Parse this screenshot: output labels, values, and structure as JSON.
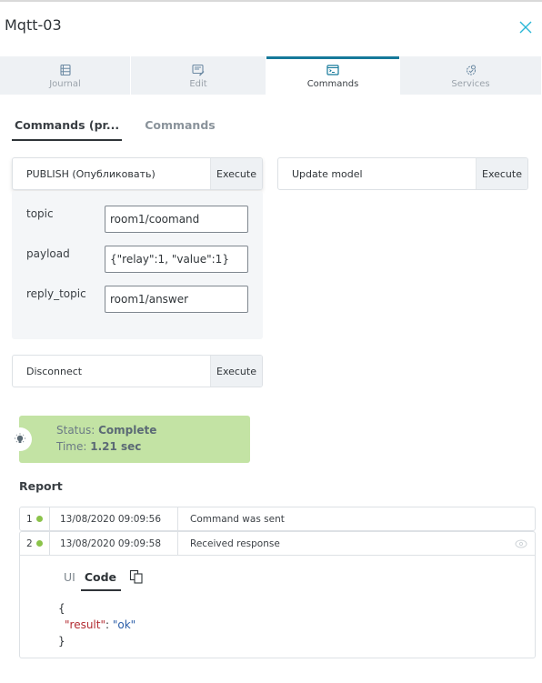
{
  "window": {
    "title": "Mqtt-03",
    "close_icon": "close-icon",
    "accent_color": "#15799a"
  },
  "tabs": [
    {
      "label": "Journal",
      "icon": "journal-icon",
      "active": false
    },
    {
      "label": "Edit",
      "icon": "edit-icon",
      "active": false
    },
    {
      "label": "Commands",
      "icon": "terminal-icon",
      "active": true
    },
    {
      "label": "Services",
      "icon": "services-gear-icon",
      "active": false
    }
  ],
  "subtabs": [
    {
      "label": "Commands (pr...",
      "active": true
    },
    {
      "label": "Commands",
      "active": false
    }
  ],
  "commands": {
    "publish": {
      "name": "PUBLISH (Опубликовать)",
      "execute_label": "Execute"
    },
    "update_model": {
      "name": "Update model",
      "execute_label": "Execute"
    },
    "disconnect": {
      "name": "Disconnect",
      "execute_label": "Execute"
    }
  },
  "params": [
    {
      "label": "topic",
      "value": "room1/coomand"
    },
    {
      "label": "payload",
      "value": "{\"relay\":1, \"value\":1}"
    },
    {
      "label": "reply_topic",
      "value": "room1/answer"
    }
  ],
  "status": {
    "status_prefix": "Status: ",
    "status_value": "Complete",
    "time_prefix": "Time: ",
    "time_value": "1.21 sec",
    "color": "#c3e3a4",
    "icon": "lightbulb-icon"
  },
  "report": {
    "title": "Report",
    "rows": [
      {
        "num": "1",
        "time": "13/08/2020 09:09:56",
        "message": "Command was sent",
        "status_color": "#8bc34a"
      },
      {
        "num": "2",
        "time": "13/08/2020 09:09:58",
        "message": "Received response",
        "status_color": "#8bc34a"
      }
    ],
    "detail": {
      "tabs": [
        {
          "label": "UI",
          "active": false
        },
        {
          "label": "Code",
          "active": true
        }
      ],
      "copy_icon": "copy-icon",
      "code": {
        "open": "{",
        "key": "\"result\"",
        "sep": ": ",
        "value": "\"ok\"",
        "close": "}"
      }
    }
  }
}
